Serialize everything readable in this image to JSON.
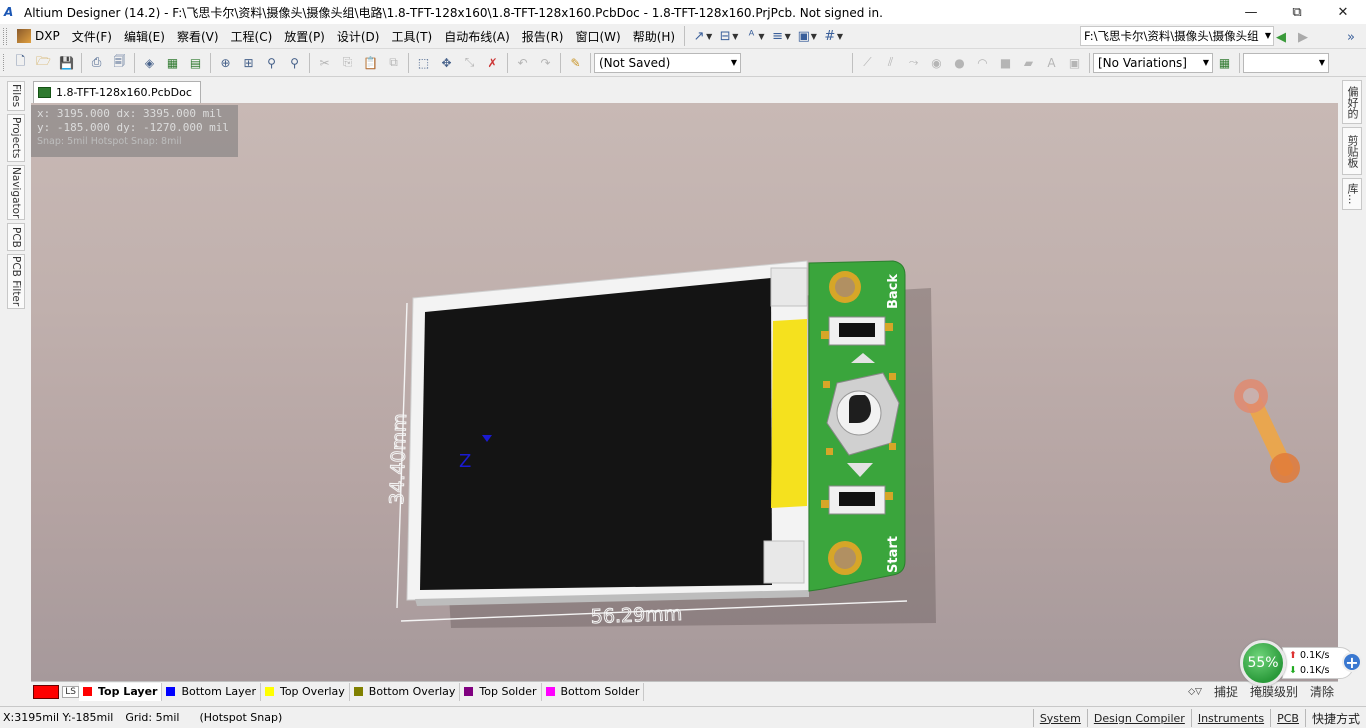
{
  "window": {
    "app_icon": "A",
    "title": "Altium Designer (14.2) - F:\\飞思卡尔\\资料\\摄像头\\摄像头组\\电路\\1.8-TFT-128x160\\1.8-TFT-128x160.PcbDoc - 1.8-TFT-128x160.PrjPcb. Not signed in.",
    "minimize": "—",
    "maximize": "⧉",
    "close": "✕"
  },
  "menu": {
    "items": [
      "DXP",
      "文件(F)",
      "编辑(E)",
      "察看(V)",
      "工程(C)",
      "放置(P)",
      "设计(D)",
      "工具(T)",
      "自动布线(A)",
      "报告(R)",
      "窗口(W)",
      "帮助(H)"
    ],
    "path_combo": "F:\\飞思卡尔\\资料\\摄像头\\摄像头组"
  },
  "toolbar": {
    "save_state": "(Not Saved)",
    "variations": "[No Variations]",
    "empty_combo": ""
  },
  "left_panels": [
    "Files",
    "Projects",
    "Navigator",
    "PCB",
    "PCB Filter"
  ],
  "right_panels": [
    "偏好的",
    "剪贴板",
    "库..."
  ],
  "document": {
    "tab_label": "1.8-TFT-128x160.PcbDoc"
  },
  "coords": {
    "line1": "x:  3195.000   dx:  3395.000 mil",
    "line2": "y:  -185.000   dy:  -1270.000 mil",
    "snap": "Snap: 5mil Hotspot Snap: 8mil"
  },
  "board": {
    "dimension_height": "34.40mm",
    "dimension_width": "56.29mm",
    "label_back": "Back",
    "label_start": "Start",
    "axis_z": "Z",
    "colors": {
      "pcb_green": "#3aa53c",
      "screen": "#141414",
      "frame": "#f3f3f3",
      "fpc": "#f5e11e",
      "pad_gold": "#d6a628"
    }
  },
  "layers": {
    "ls_label": "LS",
    "tabs": [
      {
        "label": "Top Layer",
        "color": "#ff0000",
        "active": true
      },
      {
        "label": "Bottom Layer",
        "color": "#0000ff",
        "active": false
      },
      {
        "label": "Top Overlay",
        "color": "#ffff00",
        "active": false
      },
      {
        "label": "Bottom Overlay",
        "color": "#808000",
        "active": false
      },
      {
        "label": "Top Solder",
        "color": "#800080",
        "active": false
      },
      {
        "label": "Bottom Solder",
        "color": "#ff00ff",
        "active": false
      }
    ],
    "right": {
      "snap": "捕捉",
      "mask": "掩膜级别",
      "clear": "清除"
    }
  },
  "status": {
    "position": "X:3195mil Y:-185mil",
    "grid": "Grid: 5mil",
    "hotspot": "(Hotspot Snap)",
    "buttons": [
      "System",
      "Design Compiler",
      "Instruments",
      "PCB",
      "快捷方式"
    ]
  },
  "network": {
    "percent": "55%",
    "up": "0.1K/s",
    "down": "0.1K/s"
  }
}
